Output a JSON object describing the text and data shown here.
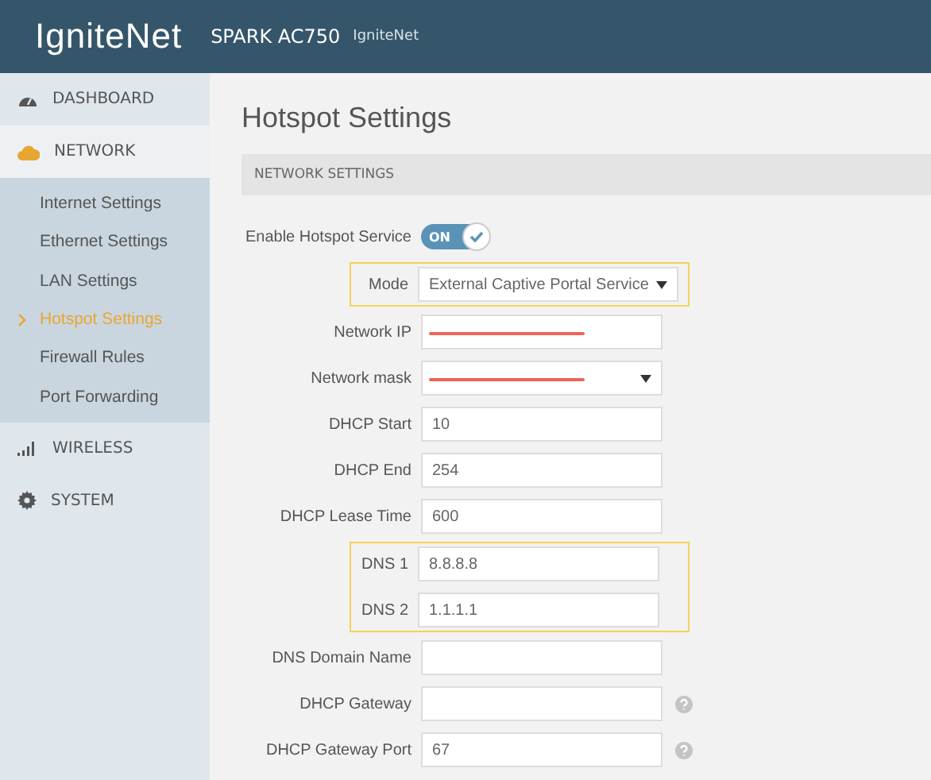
{
  "header": {
    "logo": "IgniteNet",
    "device": "SPARK AC750",
    "brand": "IgniteNet"
  },
  "sidebar": [
    {
      "label": "DASHBOARD",
      "expanded": false
    },
    {
      "label": "NETWORK",
      "expanded": true,
      "children": [
        {
          "label": "Internet Settings",
          "selected": false
        },
        {
          "label": "Ethernet Settings",
          "selected": false
        },
        {
          "label": "LAN Settings",
          "selected": false
        },
        {
          "label": "Hotspot Settings",
          "selected": true
        },
        {
          "label": "Firewall Rules",
          "selected": false
        },
        {
          "label": "Port Forwarding",
          "selected": false
        }
      ]
    },
    {
      "label": "WIRELESS",
      "expanded": false
    },
    {
      "label": "SYSTEM",
      "expanded": false
    }
  ],
  "page_title": "Hotspot Settings",
  "section_title": "NETWORK SETTINGS",
  "form": [
    {
      "highlighted": false,
      "rows": [
        {
          "kind": "toggle",
          "label": "Enable Hotspot Service",
          "value": "ON",
          "on": true
        }
      ]
    },
    {
      "highlighted": true,
      "rows": [
        {
          "kind": "select",
          "label": "Mode",
          "value": "External Captive Portal Service",
          "redacted": false,
          "help": false
        }
      ]
    },
    {
      "highlighted": false,
      "rows": [
        {
          "kind": "text",
          "label": "Network IP",
          "redacted": true,
          "help": false
        },
        {
          "kind": "select",
          "label": "Network mask",
          "redacted": true,
          "help": false
        },
        {
          "kind": "text",
          "label": "DHCP Start",
          "value": "10",
          "redacted": false,
          "help": false
        },
        {
          "kind": "text",
          "label": "DHCP End",
          "value": "254",
          "redacted": false,
          "help": false
        },
        {
          "kind": "text",
          "label": "DHCP Lease Time",
          "value": "600",
          "redacted": false,
          "help": false
        }
      ]
    },
    {
      "highlighted": true,
      "rows": [
        {
          "kind": "text",
          "label": "DNS 1",
          "value": "8.8.8.8",
          "redacted": false,
          "help": false
        },
        {
          "kind": "text",
          "label": "DNS 2",
          "value": "1.1.1.1",
          "redacted": false,
          "help": false
        }
      ]
    },
    {
      "highlighted": false,
      "rows": [
        {
          "kind": "text",
          "label": "DNS Domain Name",
          "redacted": false,
          "help": false
        },
        {
          "kind": "text",
          "label": "DHCP Gateway",
          "redacted": false,
          "help": true
        },
        {
          "kind": "text",
          "label": "DHCP Gateway Port",
          "value": "67",
          "redacted": false,
          "help": true
        }
      ]
    }
  ]
}
